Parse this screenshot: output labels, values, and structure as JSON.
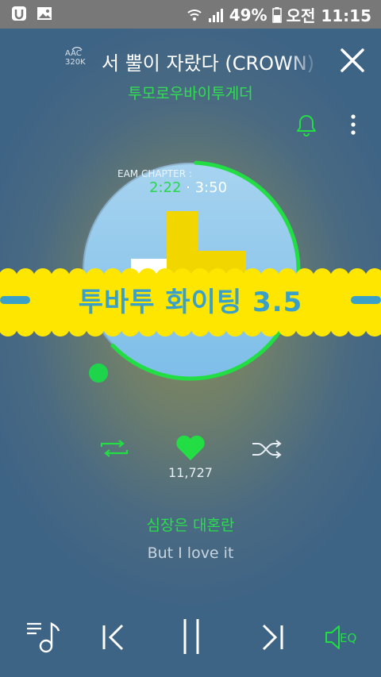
{
  "status_bar": {
    "battery": "49%",
    "time": "오전 11:15"
  },
  "header": {
    "quality_line1": "AAC",
    "quality_line2": "320K",
    "song_title": "서 뿔이 자랐다 (CROWN)",
    "artist": "투모로우바이투게더"
  },
  "player": {
    "album_chapter_text": "EAM CHAPTER :",
    "current_time": "2:22",
    "separator": " · ",
    "total_time": "3:50",
    "banner_text": "투바투 화이팅 3.5",
    "progress_fraction": 0.62,
    "like_count": "11,727"
  },
  "lyrics": {
    "current": "심장은 대혼란",
    "next": "But I love it"
  },
  "bottom": {
    "eq_label": "EQ"
  },
  "colors": {
    "accent": "#22dd44",
    "banner": "#ffe600"
  }
}
